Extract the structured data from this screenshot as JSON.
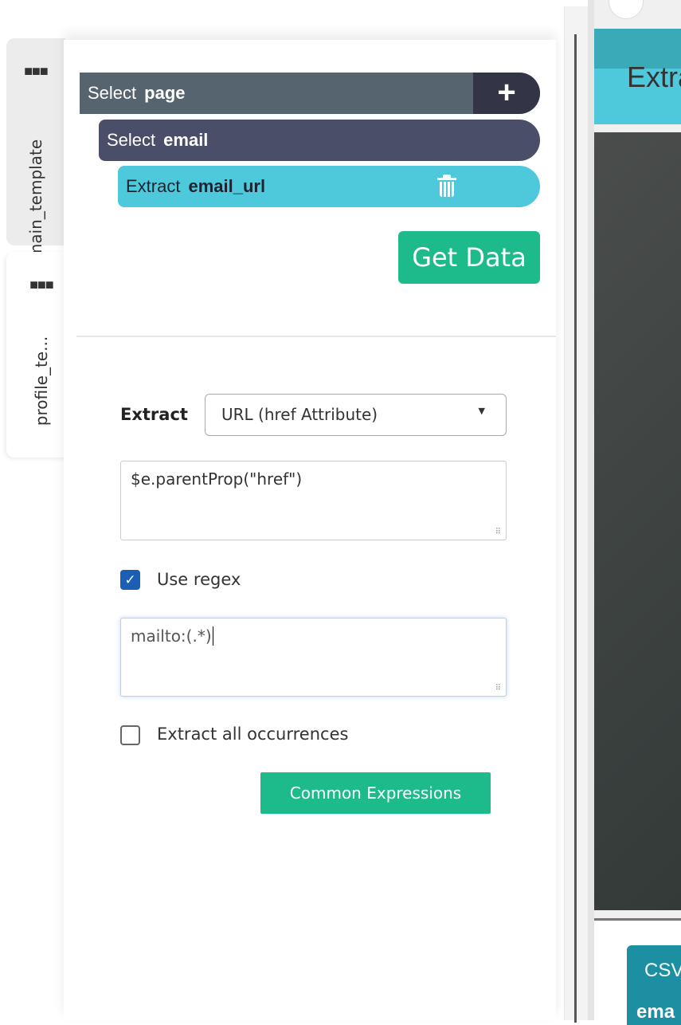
{
  "tabs": [
    {
      "label": "main_template",
      "menu_icon": "ellipsis-icon"
    },
    {
      "label": "profile_te...",
      "menu_icon": "ellipsis-icon"
    }
  ],
  "tree": [
    {
      "action": "Select",
      "name": "page",
      "color": "#56646f",
      "button_icon": "plus-icon"
    },
    {
      "action": "Select",
      "name": "email",
      "color": "#4a4e68"
    },
    {
      "action": "Extract",
      "name": "email_url",
      "color": "#4ec9dc",
      "button_icon": "trash-icon"
    }
  ],
  "get_data_label": "Get Data",
  "extract": {
    "label": "Extract",
    "selected": "URL (href Attribute)",
    "expression": "$e.parentProp(\"href\")",
    "use_regex_label": "Use regex",
    "use_regex": true,
    "regex": "mailto:(.*)",
    "extract_all_label": "Extract all occurrences",
    "extract_all": false,
    "common_expressions_label": "Common Expressions"
  },
  "right": {
    "header_text": "Extra",
    "csv_label": "CSV",
    "email_text": "ema"
  },
  "colors": {
    "accent": "#1dbb8b",
    "teal": "#4ec9dc",
    "checkbox": "#1a5fb4"
  }
}
